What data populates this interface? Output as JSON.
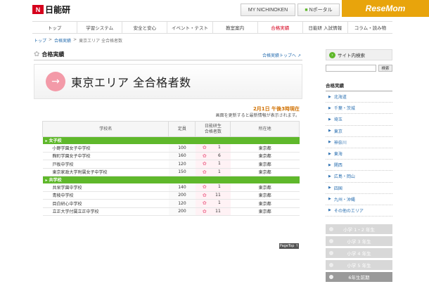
{
  "header": {
    "logo_text": "日能研",
    "logo_mark": "N",
    "my_button": "MY NICHINOKEN",
    "portal_button": "Nポータル",
    "watermark": "ReseMom"
  },
  "nav": {
    "items": [
      "トップ",
      "学習システム",
      "安全と安心",
      "イベント・テスト",
      "教室案内",
      "合格実績",
      "日能研 入試情報",
      "コラム・読み物"
    ]
  },
  "breadcrumb": [
    "トップ",
    ">",
    "合格実績",
    ">",
    "東京エリア 全合格者数"
  ],
  "section": {
    "title": "合格実績",
    "link": "合格実績トップへ"
  },
  "hero": {
    "title": "東京エリア 全合格者数",
    "arrow": "→"
  },
  "status": {
    "date": "2月1日 午後3時現在",
    "note": "画面を更新すると最新情報が表示されます。"
  },
  "table": {
    "headers": {
      "name": "学校名",
      "capacity": "定員",
      "count": "日能研生\n合格者数",
      "location": "所在地"
    },
    "groups": [
      {
        "label": "女子校",
        "rows": [
          {
            "name": "小野学園女子中学校",
            "capacity": "100",
            "count": "1",
            "location": "東京都"
          },
          {
            "name": "麹町学園女子中学校",
            "capacity": "160",
            "count": "6",
            "location": "東京都"
          },
          {
            "name": "戸板中学校",
            "capacity": "120",
            "count": "1",
            "location": "東京都"
          },
          {
            "name": "東京家政大学附属女子中学校",
            "capacity": "150",
            "count": "1",
            "location": "東京都"
          }
        ]
      },
      {
        "label": "共学校",
        "rows": [
          {
            "name": "共栄学園中学校",
            "capacity": "140",
            "count": "1",
            "location": "東京都"
          },
          {
            "name": "青稜中学校",
            "capacity": "200",
            "count": "11",
            "location": "東京都"
          },
          {
            "name": "目白研心中学校",
            "capacity": "120",
            "count": "1",
            "location": "東京都"
          },
          {
            "name": "立正大学付属立正中学校",
            "capacity": "200",
            "count": "11",
            "location": "東京都"
          }
        ]
      }
    ]
  },
  "pagetop": "PageTop ↑",
  "sidebar": {
    "search_title": "サイト内検索",
    "search_button": "検索",
    "category_title": "合格実績",
    "areas": [
      "北海道",
      "千葉・茨城",
      "埼玉",
      "東京",
      "神奈川",
      "東海",
      "関西",
      "広島・岡山",
      "四国",
      "九州・沖縄",
      "その他のエリア"
    ],
    "grades": [
      "小学 1・2 年生",
      "小学 3 年生",
      "小学 4 年生",
      "小学 5 年生",
      "6年生前期"
    ]
  }
}
